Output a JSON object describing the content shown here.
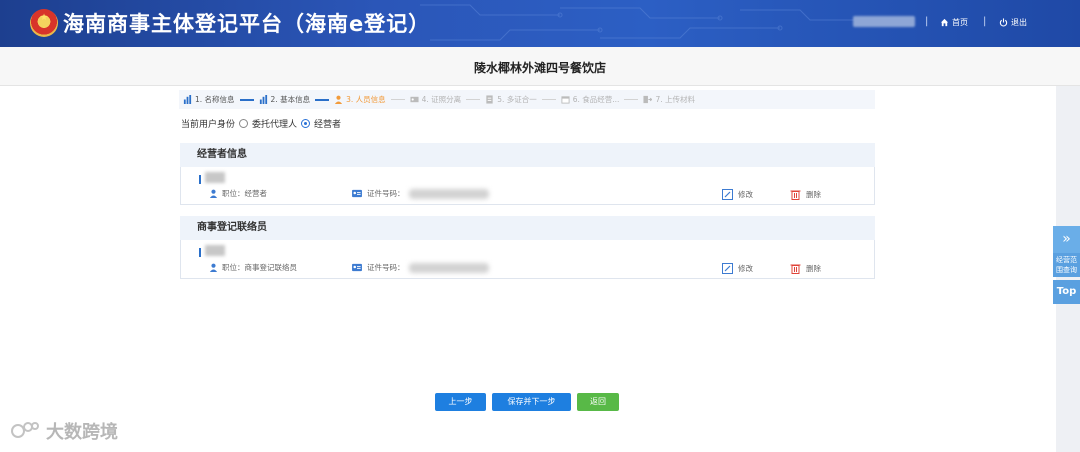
{
  "header": {
    "site_title": "海南商事主体登记平台（海南e登记）",
    "home_label": "首页",
    "logout_label": "退出"
  },
  "company_name": "陵水椰林外滩四号餐饮店",
  "steps": [
    {
      "label": "1. 名称信息",
      "state": "done"
    },
    {
      "label": "2. 基本信息",
      "state": "done"
    },
    {
      "label": "3. 人员信息",
      "state": "active"
    },
    {
      "label": "4. 证照分离",
      "state": "disabled"
    },
    {
      "label": "5. 多证合一",
      "state": "disabled"
    },
    {
      "label": "6. 食品经营...",
      "state": "disabled"
    },
    {
      "label": "7. 上传材料",
      "state": "disabled"
    }
  ],
  "identity": {
    "label": "当前用户身份",
    "option_agent": "委托代理人",
    "option_operator": "经营者",
    "selected": "经营者"
  },
  "operator_section": {
    "title": "经营者信息",
    "position": "职位：经营者",
    "id_label": "证件号码：",
    "edit_label": "修改",
    "delete_label": "删除"
  },
  "liaison_section": {
    "title": "商事登记联络员",
    "position": "职位：商事登记联络员",
    "id_label": "证件号码：",
    "edit_label": "修改",
    "delete_label": "删除"
  },
  "buttons": {
    "prev": "上一步",
    "save_next": "保存并下一步",
    "back": "返回"
  },
  "side_float": {
    "expand": "»",
    "query": "经营范围查询",
    "top": "Top"
  },
  "watermark": "大数跨境",
  "colors": {
    "header_blue": "#2b56b8",
    "accent_blue": "#1e7fe0",
    "active_step": "#f29b3b",
    "back_green": "#58b947",
    "delete_red": "#e0443a"
  }
}
